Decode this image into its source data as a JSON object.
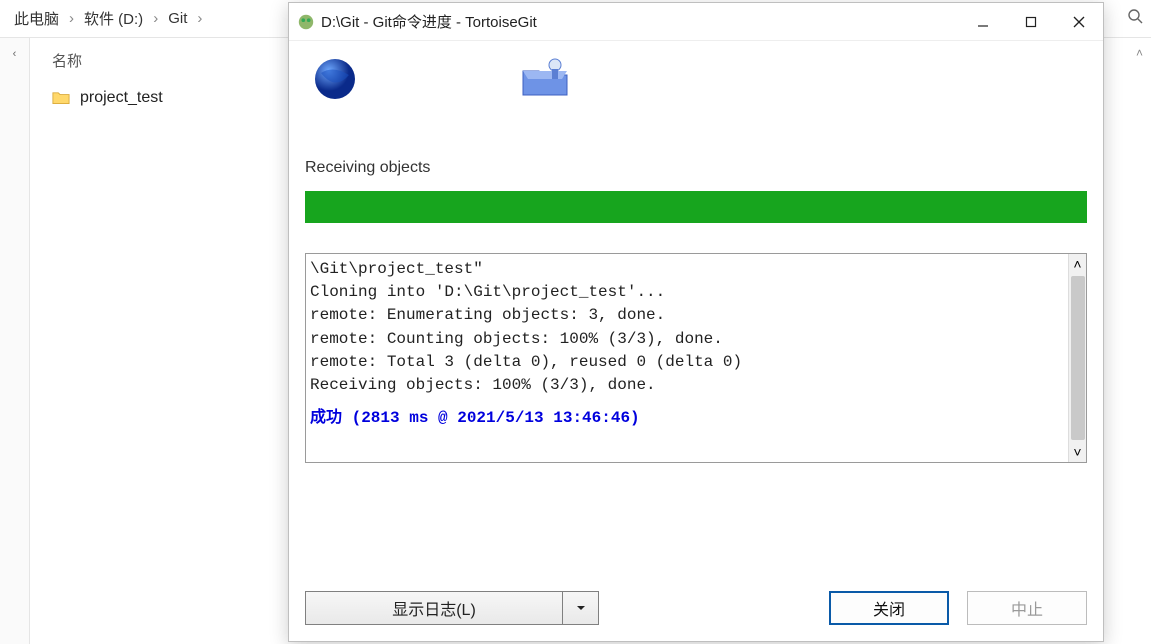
{
  "explorer": {
    "breadcrumbs": [
      "此电脑",
      "软件 (D:)",
      "Git"
    ],
    "column_header": "名称",
    "folder_name": "project_test"
  },
  "dialog": {
    "title": "D:\\Git - Git命令进度 - TortoiseGit",
    "status_label": "Receiving objects",
    "progress_percent": 100,
    "log_lines": [
      "\\Git\\project_test\"",
      "Cloning into 'D:\\Git\\project_test'...",
      "remote: Enumerating objects: 3, done.",
      "remote: Counting objects: 100% (3/3), done.",
      "remote: Total 3 (delta 0), reused 0 (delta 0)",
      "Receiving objects: 100% (3/3), done."
    ],
    "success_line": "成功 (2813 ms @ 2021/5/13 13:46:46)",
    "buttons": {
      "show_log": "显示日志(L)",
      "close": "关闭",
      "abort": "中止"
    }
  }
}
